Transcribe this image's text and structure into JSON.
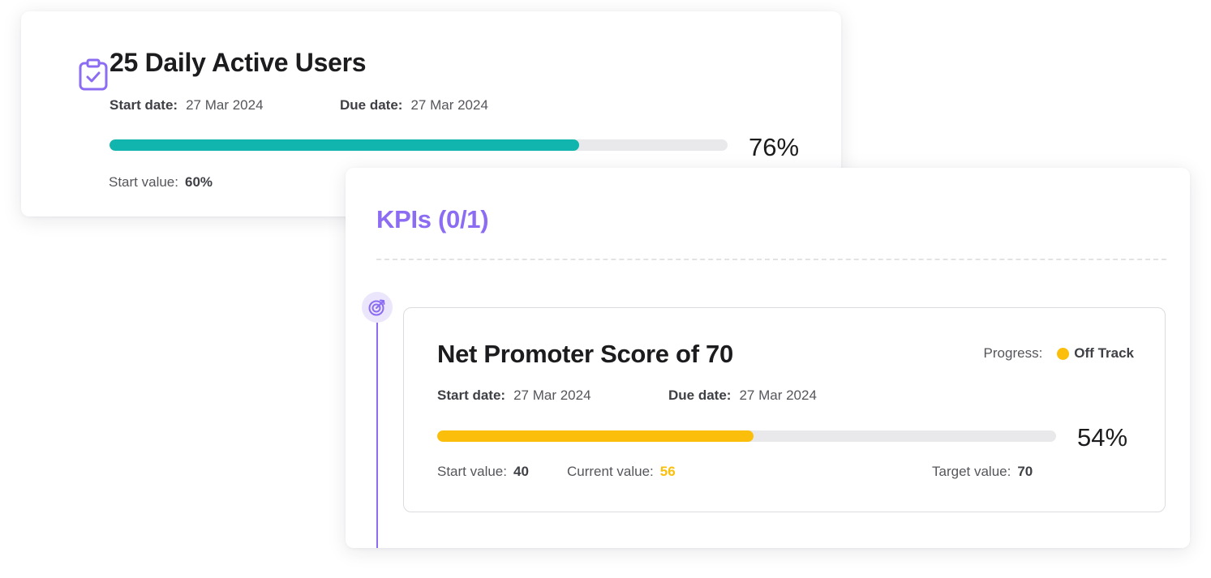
{
  "objective": {
    "title": "25 Daily Active Users",
    "icon": "clipboard-check-icon",
    "start_date_label": "Start date:",
    "start_date": "27 Mar 2024",
    "due_date_label": "Due date:",
    "due_date": "27 Mar 2024",
    "progress_percent": 76,
    "progress_label": "76%",
    "start_value_label": "Start value:",
    "start_value": "60%",
    "bar_color": "#12b5ae"
  },
  "kpis": {
    "title": "KPIs (0/1)",
    "accent_color": "#8b6cf2",
    "items": [
      {
        "name": "Net Promoter Score of 70",
        "icon": "target-icon",
        "progress_label": "Progress:",
        "status": "Off Track",
        "status_color": "#fbbf0b",
        "start_date_label": "Start date:",
        "start_date": "27 Mar 2024",
        "due_date_label": "Due date:",
        "due_date": "27 Mar 2024",
        "progress_percent": 54,
        "progress_text": "54%",
        "start_value_label": "Start value:",
        "start_value": "40",
        "current_value_label": "Current value:",
        "current_value": "56",
        "target_value_label": "Target value:",
        "target_value": "70"
      }
    ]
  }
}
